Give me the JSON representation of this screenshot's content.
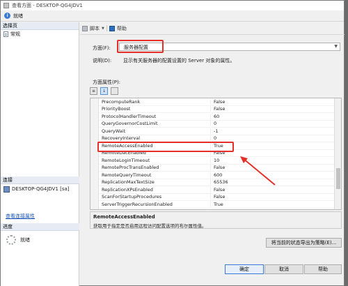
{
  "window": {
    "title": "查看方面 - DESKTOP-QG4JDV1"
  },
  "status_bar": {
    "text": "就绪"
  },
  "left_panel": {
    "select_page_header": "选择页",
    "pages": [
      {
        "label": "常规"
      }
    ],
    "connection_header": "连接",
    "connection_item": "DESKTOP-QG4JDV1 [sa]",
    "view_connection_link": "查看连接属性",
    "progress_header": "进度",
    "progress_status": "就绪"
  },
  "toolbar": {
    "script_label": "脚本",
    "help_label": "帮助"
  },
  "facet": {
    "facet_label": "方面(F):",
    "facet_value": "服务器配置",
    "description_label": "说明(D):",
    "description_text": "显示有关服务器的配置设置的 Server 对象的属性。",
    "properties_label": "方面属性(P):"
  },
  "properties": {
    "rows": [
      {
        "name": "PrecomputeRank",
        "value": "False"
      },
      {
        "name": "PriorityBoost",
        "value": "False"
      },
      {
        "name": "ProtocolHandlerTimeout",
        "value": "60"
      },
      {
        "name": "QueryGovernorCostLimit",
        "value": "0"
      },
      {
        "name": "QueryWait",
        "value": "-1"
      },
      {
        "name": "RecoveryInterval",
        "value": "0"
      },
      {
        "name": "RemoteAccessEnabled",
        "value": "True"
      },
      {
        "name": "RemoteDacEnabled",
        "value": "False"
      },
      {
        "name": "RemoteLoginTimeout",
        "value": "10"
      },
      {
        "name": "RemoteProcTransEnabled",
        "value": "False"
      },
      {
        "name": "RemoteQueryTimeout",
        "value": "600"
      },
      {
        "name": "ReplicationMaxTextSize",
        "value": "65536"
      },
      {
        "name": "ReplicationXPsEnabled",
        "value": "False"
      },
      {
        "name": "ScanForStartupProcedures",
        "value": "False"
      },
      {
        "name": "ServerTriggerRecursionEnabled",
        "value": "True"
      }
    ]
  },
  "description_box": {
    "title": "RemoteAccessEnabled",
    "text": "获取用于指定是否启用远程访问配置选项的布尔属性值。"
  },
  "buttons": {
    "export": "将当前的状态导出为策略(E)...",
    "ok": "确定",
    "cancel": "取消",
    "help": "帮助"
  },
  "colors": {
    "highlight": "#e5302a",
    "link": "#1a55b5"
  }
}
